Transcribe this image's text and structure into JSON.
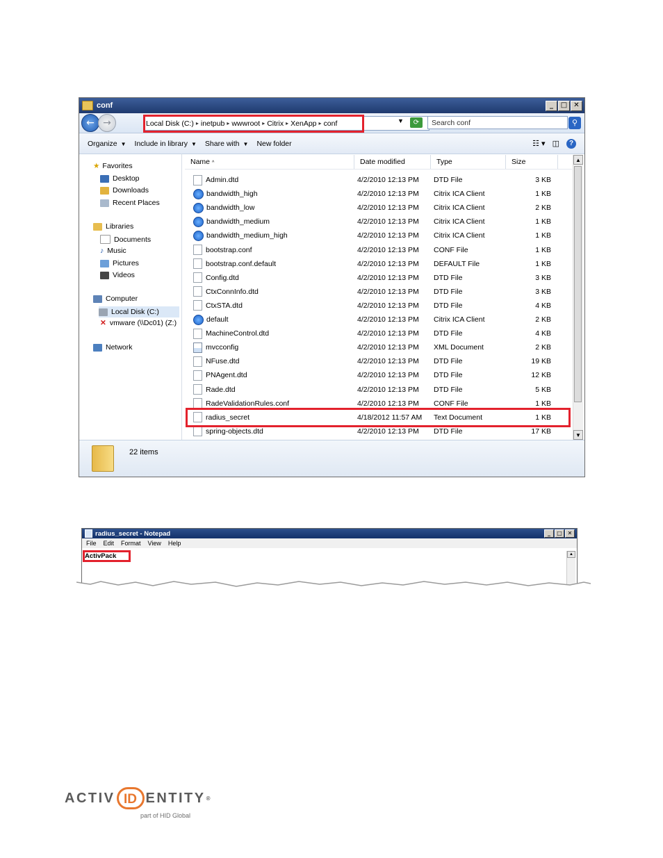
{
  "explorer": {
    "title": "conf",
    "breadcrumbs": [
      "Local Disk (C:)",
      "inetpub",
      "wwwroot",
      "Citrix",
      "XenApp",
      "conf"
    ],
    "search_placeholder": "Search conf",
    "toolbar": {
      "organize": "Organize",
      "include_in_library": "Include in library",
      "share_with": "Share with",
      "new_folder": "New folder"
    },
    "nav": {
      "favorites": "Favorites",
      "desktop": "Desktop",
      "downloads": "Downloads",
      "recent_places": "Recent Places",
      "libraries": "Libraries",
      "documents": "Documents",
      "music": "Music",
      "pictures": "Pictures",
      "videos": "Videos",
      "computer": "Computer",
      "local_disk": "Local Disk (C:)",
      "vmware": "vmware (\\\\Dc01) (Z:)",
      "network": "Network"
    },
    "columns": {
      "name": "Name",
      "date": "Date modified",
      "type": "Type",
      "size": "Size"
    },
    "files": [
      {
        "name": "Admin.dtd",
        "date": "4/2/2010 12:13 PM",
        "type": "DTD File",
        "size": "3 KB",
        "icon": "doc"
      },
      {
        "name": "bandwidth_high",
        "date": "4/2/2010 12:13 PM",
        "type": "Citrix ICA Client",
        "size": "1 KB",
        "icon": "ica"
      },
      {
        "name": "bandwidth_low",
        "date": "4/2/2010 12:13 PM",
        "type": "Citrix ICA Client",
        "size": "2 KB",
        "icon": "ica"
      },
      {
        "name": "bandwidth_medium",
        "date": "4/2/2010 12:13 PM",
        "type": "Citrix ICA Client",
        "size": "1 KB",
        "icon": "ica"
      },
      {
        "name": "bandwidth_medium_high",
        "date": "4/2/2010 12:13 PM",
        "type": "Citrix ICA Client",
        "size": "1 KB",
        "icon": "ica"
      },
      {
        "name": "bootstrap.conf",
        "date": "4/2/2010 12:13 PM",
        "type": "CONF File",
        "size": "1 KB",
        "icon": "doc"
      },
      {
        "name": "bootstrap.conf.default",
        "date": "4/2/2010 12:13 PM",
        "type": "DEFAULT File",
        "size": "1 KB",
        "icon": "doc"
      },
      {
        "name": "Config.dtd",
        "date": "4/2/2010 12:13 PM",
        "type": "DTD File",
        "size": "3 KB",
        "icon": "doc"
      },
      {
        "name": "CtxConnInfo.dtd",
        "date": "4/2/2010 12:13 PM",
        "type": "DTD File",
        "size": "3 KB",
        "icon": "doc"
      },
      {
        "name": "CtxSTA.dtd",
        "date": "4/2/2010 12:13 PM",
        "type": "DTD File",
        "size": "4 KB",
        "icon": "doc"
      },
      {
        "name": "default",
        "date": "4/2/2010 12:13 PM",
        "type": "Citrix ICA Client",
        "size": "2 KB",
        "icon": "ica"
      },
      {
        "name": "MachineControl.dtd",
        "date": "4/2/2010 12:13 PM",
        "type": "DTD File",
        "size": "4 KB",
        "icon": "doc"
      },
      {
        "name": "mvcconfig",
        "date": "4/2/2010 12:13 PM",
        "type": "XML Document",
        "size": "2 KB",
        "icon": "xml"
      },
      {
        "name": "NFuse.dtd",
        "date": "4/2/2010 12:13 PM",
        "type": "DTD File",
        "size": "19 KB",
        "icon": "doc"
      },
      {
        "name": "PNAgent.dtd",
        "date": "4/2/2010 12:13 PM",
        "type": "DTD File",
        "size": "12 KB",
        "icon": "doc"
      },
      {
        "name": "Rade.dtd",
        "date": "4/2/2010 12:13 PM",
        "type": "DTD File",
        "size": "5 KB",
        "icon": "doc"
      },
      {
        "name": "RadeValidationRules.conf",
        "date": "4/2/2010 12:13 PM",
        "type": "CONF File",
        "size": "1 KB",
        "icon": "doc"
      },
      {
        "name": "radius_secret",
        "date": "4/18/2012 11:57 AM",
        "type": "Text Document",
        "size": "1 KB",
        "icon": "doc"
      },
      {
        "name": "spring-objects.dtd",
        "date": "4/2/2010 12:13 PM",
        "type": "DTD File",
        "size": "17 KB",
        "icon": "doc"
      }
    ],
    "status": "22 items"
  },
  "notepad": {
    "title": "radius_secret - Notepad",
    "menu": [
      "File",
      "Edit",
      "Format",
      "View",
      "Help"
    ],
    "content": "ActivPack"
  },
  "logo": {
    "part1": "ACTIV",
    "id": "ID",
    "part2": "ENTITY",
    "reg": "®",
    "tagline": "part of HID Global",
    "accent_color": "#e8772e"
  }
}
